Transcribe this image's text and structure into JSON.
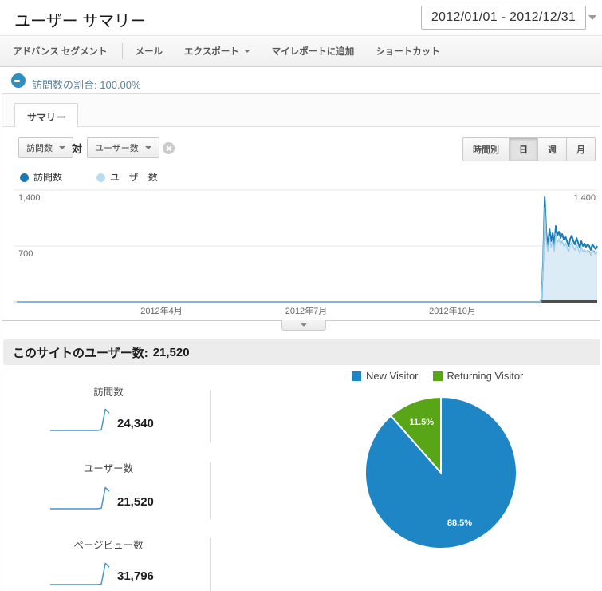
{
  "header": {
    "title": "ユーザー サマリー",
    "date_range": "2012/01/01 - 2012/12/31"
  },
  "toolbar": {
    "items": [
      {
        "label": "アドバンス セグメント"
      },
      {
        "label": "メール"
      },
      {
        "label": "エクスポート",
        "has_caret": true
      },
      {
        "label": "マイレポートに追加"
      },
      {
        "label": "ショートカット"
      }
    ]
  },
  "segment": {
    "icon": "segment-donut-icon",
    "label": "訪問数の割合:",
    "value": "100.00%"
  },
  "tabs": [
    {
      "label": "サマリー",
      "active": true
    }
  ],
  "metric_selectors": {
    "primary": "訪問数",
    "vs": "対",
    "secondary": "ユーザー数",
    "remove_icon": "circle-x-icon"
  },
  "granularity": {
    "options": [
      {
        "label": "時間別",
        "selected": false
      },
      {
        "label": "日",
        "selected": true
      },
      {
        "label": "週",
        "selected": false
      },
      {
        "label": "月",
        "selected": false
      }
    ]
  },
  "chart_legend": [
    {
      "label": "訪問数",
      "color": "#1b7ab3"
    },
    {
      "label": "ユーザー数",
      "color": "#b5dcf4"
    }
  ],
  "summary_banner": {
    "label": "このサイトのユーザー数:",
    "value": "21,520"
  },
  "metrics": [
    {
      "label": "訪問数",
      "value": "24,340"
    },
    {
      "label": "ユーザー数",
      "value": "21,520"
    },
    {
      "label": "ページビュー数",
      "value": "31,796"
    }
  ],
  "spark_shape": [
    0,
    0,
    0,
    0,
    0,
    0,
    0,
    0,
    0,
    0,
    0,
    0,
    0,
    0.03,
    0.95,
    0.78
  ],
  "pie_legend": [
    {
      "label": "New Visitor",
      "color": "#1e86c5"
    },
    {
      "label": "Returning Visitor",
      "color": "#58a618"
    }
  ],
  "chart_data": [
    {
      "type": "line",
      "granularity": "日",
      "x_range": [
        "2012-01-01",
        "2012-12-31"
      ],
      "ylim": [
        0,
        1400
      ],
      "yticks": [
        {
          "value": 1400,
          "label": "1,400"
        },
        {
          "value": 700,
          "label": "700"
        }
      ],
      "xticks": [
        {
          "date": "2012-04-01",
          "label": "2012年4月"
        },
        {
          "date": "2012-07-01",
          "label": "2012年7月"
        },
        {
          "date": "2012-10-01",
          "label": "2012年10月"
        }
      ],
      "series": [
        {
          "name": "訪問数",
          "color": "#1b7ab3",
          "spike_start": "2012-11-26",
          "daily": [
            30,
            520,
            1310,
            860,
            700,
            910,
            760,
            860,
            700,
            950,
            830,
            880,
            800,
            850,
            780,
            820,
            760,
            700,
            790,
            830,
            760,
            720,
            800,
            740,
            680,
            760,
            700,
            730,
            690,
            720,
            700,
            650,
            720,
            690,
            660,
            700
          ]
        },
        {
          "name": "ユーザー数",
          "color": "#9fcdec",
          "fill": "#dcecf7",
          "spike_start": "2012-11-26",
          "daily": [
            25,
            470,
            1180,
            775,
            630,
            820,
            685,
            775,
            630,
            855,
            745,
            790,
            720,
            765,
            700,
            740,
            685,
            630,
            710,
            745,
            685,
            650,
            720,
            665,
            610,
            685,
            630,
            655,
            620,
            650,
            630,
            585,
            650,
            620,
            595,
            630
          ]
        }
      ],
      "selection": {
        "from": "2012-11-26",
        "to": "2012-12-31",
        "color": "#4d4d4d"
      }
    },
    {
      "type": "pie",
      "slices": [
        {
          "label": "New Visitor",
          "pct": 88.5,
          "pct_label": "88.5%",
          "color": "#1e86c5"
        },
        {
          "label": "Returning Visitor",
          "pct": 11.5,
          "pct_label": "11.5%",
          "color": "#58a618"
        }
      ],
      "legend_position": "top"
    }
  ]
}
